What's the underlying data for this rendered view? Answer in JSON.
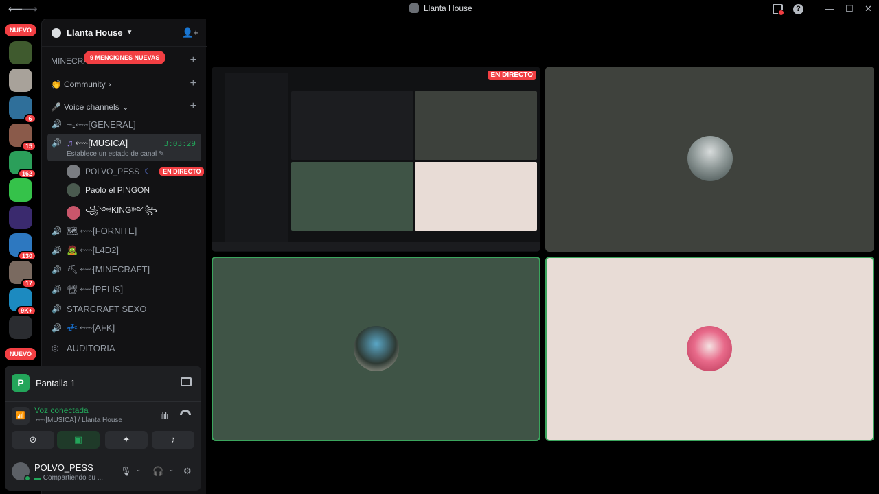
{
  "window": {
    "title": "Llanta House",
    "back_icon": "arrow-left-icon",
    "forward_icon": "arrow-right-icon",
    "minimize": "—",
    "maximize": "☐",
    "close": "✕"
  },
  "rail": {
    "nuevo_label": "NUEVO",
    "servers": [
      {
        "badge": "",
        "color": "#3f5a2e"
      },
      {
        "badge": "",
        "color": "#a8a29a"
      },
      {
        "badge": "6",
        "color": "#2f6f9a"
      },
      {
        "badge": "15",
        "color": "#8a5a4a"
      },
      {
        "badge": "162",
        "color": "#2b9f5a"
      },
      {
        "badge": "",
        "color": "#35c24a"
      },
      {
        "badge": "",
        "color": "#3a2a6e"
      },
      {
        "badge": "130",
        "color": "#2d78c0"
      },
      {
        "badge": "17",
        "color": "#7a6a60"
      },
      {
        "badge": "9K+",
        "color": "#1c8ac0"
      },
      {
        "badge": "",
        "color": "#2a2c30"
      }
    ]
  },
  "guild": {
    "name": "Llanta House",
    "category_minecraft": "MINECRA",
    "mentions_label": "9 MENCIONES NUEVAS",
    "category_community": "Community",
    "category_voice": "Voice channels",
    "channels": {
      "general": "ᯓ⬳[GENERAL]",
      "musica": "⬳[MUSICA]",
      "musica_time": "3:03:29",
      "musica_status": "Establece un estado de canal",
      "fornite": "⬳[FORNITE]",
      "l4d2": "⬳[L4D2]",
      "minecraft": "⬳[MINECRAFT]",
      "pelis": "⬳[PELIS]",
      "starcraft": "STARCRAFT SEXO",
      "afk": "⬳[AFK]",
      "auditoria": "AUDITORIA"
    },
    "voice_users": [
      {
        "name": "POLVO_PESS",
        "live": "EN DIRECTO"
      },
      {
        "name": "Paolo el PINGON"
      },
      {
        "name": "꧁༺KING༻꧂"
      }
    ]
  },
  "panel": {
    "screen_letter": "P",
    "screen_label": "Pantalla 1",
    "voice_status": "Voz conectada",
    "voice_where": "⬳[MUSICA] / Llanta House",
    "username": "POLVO_PESS",
    "user_status": "Compartiendo su ..."
  },
  "stage": {
    "live_label": "EN DIRECTO"
  }
}
